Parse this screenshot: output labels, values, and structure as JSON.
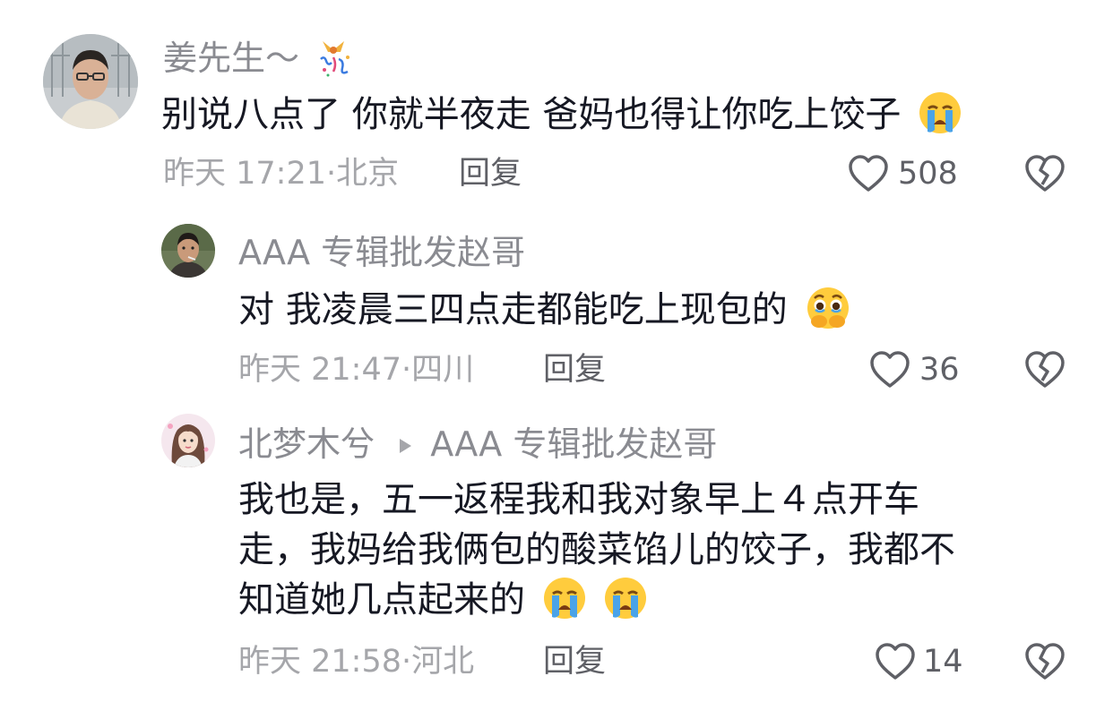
{
  "comments": [
    {
      "user": "姜先生～",
      "text": "别说八点了 你就半夜走 爸妈也得让你吃上饺子",
      "time": "昨天 17:21",
      "location": "北京",
      "reply_label": "回复",
      "likes": "508"
    },
    {
      "user": "AAA 专辑批发赵哥",
      "text": "对 我凌晨三四点走都能吃上现包的",
      "time": "昨天 21:47",
      "location": "四川",
      "reply_label": "回复",
      "likes": "36"
    },
    {
      "user": "北梦木兮",
      "reply_to": "AAA 专辑批发赵哥",
      "text_lines": [
        "我也是，五一返程我和我对象早上４点开车",
        "走，我妈给我俩包的酸菜馅儿的饺子，我都不",
        "知道她几点起来的"
      ],
      "time": "昨天 21:58",
      "location": "河北",
      "reply_label": "回复",
      "likes": "14"
    }
  ],
  "icons": {
    "like": "heart-outline-icon",
    "dislike": "broken-heart-icon",
    "emoji_cry": "loudly-crying-face-emoji",
    "emoji_tears": "holding-back-tears-emoji",
    "reply_arrow": "play-triangle-icon"
  },
  "colors": {
    "text": "#161823",
    "name": "#8a8b91",
    "meta": "#a5a6aa",
    "action": "#5f6066"
  }
}
